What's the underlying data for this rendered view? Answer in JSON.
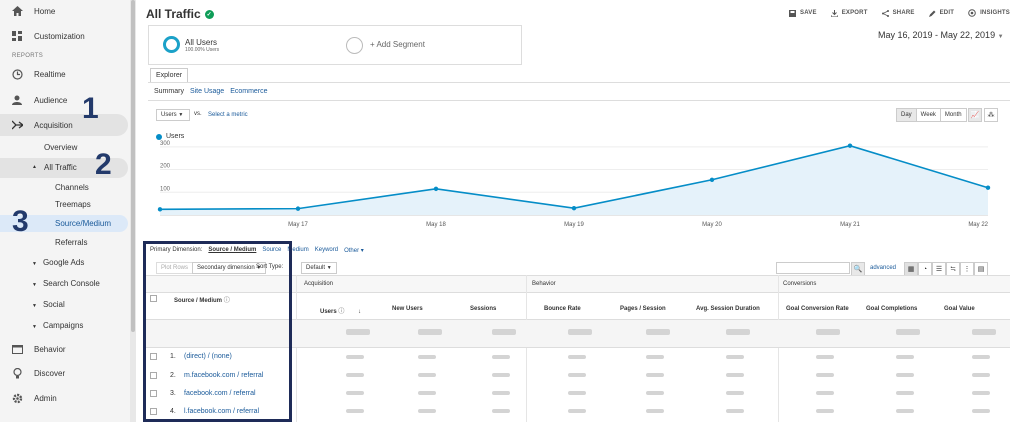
{
  "sidebar": {
    "home": "Home",
    "customization": "Customization",
    "reports_label": "REPORTS",
    "realtime": "Realtime",
    "audience": "Audience",
    "acquisition": "Acquisition",
    "overview": "Overview",
    "all_traffic": "All Traffic",
    "channels": "Channels",
    "treemaps": "Treemaps",
    "source_medium": "Source/Medium",
    "referrals": "Referrals",
    "google_ads": "Google Ads",
    "search_console": "Search Console",
    "social": "Social",
    "campaigns": "Campaigns",
    "behavior": "Behavior",
    "discover": "Discover",
    "admin": "Admin",
    "step1": "1",
    "step2": "2",
    "step3": "3"
  },
  "header": {
    "title": "All Traffic",
    "save": "SAVE",
    "export": "EXPORT",
    "share": "SHARE",
    "edit": "EDIT",
    "insights": "INSIGHTS"
  },
  "segments": {
    "all_users": "All Users",
    "all_users_sub": "100.00% Users",
    "add_segment": "+ Add Segment"
  },
  "date_range": "May 16, 2019 - May 22, 2019",
  "tabs": {
    "explorer": "Explorer",
    "summary": "Summary",
    "site_usage": "Site Usage",
    "ecommerce": "Ecommerce"
  },
  "chart_controls": {
    "metric": "Users",
    "vs": "vs.",
    "select_metric": "Select a metric",
    "day": "Day",
    "week": "Week",
    "month": "Month"
  },
  "chart_data": {
    "type": "area",
    "series": [
      {
        "name": "Users",
        "values": [
          25,
          28,
          115,
          30,
          155,
          305,
          120
        ]
      }
    ],
    "x": [
      "",
      "May 17",
      "May 18",
      "May 19",
      "May 20",
      "May 21",
      "May 22"
    ],
    "yticks": [
      "300",
      "200",
      "100"
    ],
    "ylim": [
      0,
      330
    ],
    "color": "#058dc7"
  },
  "dimensions": {
    "primary_label": "Primary Dimension:",
    "source_medium": "Source / Medium",
    "source": "Source",
    "medium": "Medium",
    "keyword": "Keyword",
    "other": "Other"
  },
  "table_controls": {
    "plot_rows": "Plot Rows",
    "secondary_dimension": "Secondary dimension",
    "sort_type": "Sort Type:",
    "default": "Default",
    "advanced": "advanced"
  },
  "table": {
    "dimension_header": "Source / Medium",
    "groups": [
      "Acquisition",
      "Behavior",
      "Conversions"
    ],
    "columns": [
      "Users",
      "New Users",
      "Sessions",
      "Bounce Rate",
      "Pages / Session",
      "Avg. Session Duration",
      "Goal Conversion Rate",
      "Goal Completions",
      "Goal Value"
    ],
    "rows": [
      {
        "num": "1.",
        "label": "(direct) / (none)"
      },
      {
        "num": "2.",
        "label": "m.facebook.com / referral"
      },
      {
        "num": "3.",
        "label": "facebook.com / referral"
      },
      {
        "num": "4.",
        "label": "l.facebook.com / referral"
      }
    ]
  }
}
